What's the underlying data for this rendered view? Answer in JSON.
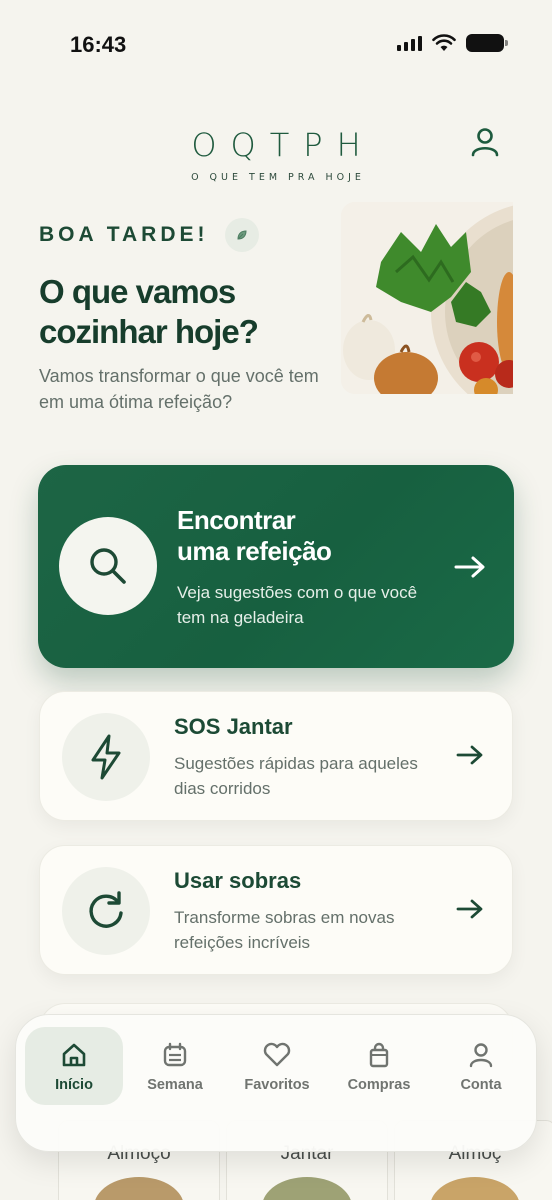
{
  "status": {
    "time": "16:43"
  },
  "brand": {
    "title": "OQTPH",
    "subtitle": "O QUE TEM PRA HOJE"
  },
  "greeting": {
    "label": "BOA TARDE!",
    "headline_line1": "O que vamos",
    "headline_line2": "cozinhar hoje?",
    "subtext": "Vamos transformar o que você tem em uma ótima refeição?"
  },
  "primary_card": {
    "title_line1": "Encontrar",
    "title_line2": "uma refeição",
    "description": "Veja sugestões com o que você tem na geladeira"
  },
  "cards": [
    {
      "title": "SOS Jantar",
      "description": "Sugestões rápidas para aqueles dias corridos",
      "icon": "lightning-icon"
    },
    {
      "title": "Usar sobras",
      "description": "Transforme sobras em novas refeições incríveis",
      "icon": "refresh-icon"
    }
  ],
  "meals": [
    "Almoço",
    "Jantar",
    "Almoç"
  ],
  "nav": {
    "items": [
      {
        "label": "Início",
        "icon": "home-icon",
        "active": true
      },
      {
        "label": "Semana",
        "icon": "calendar-icon",
        "active": false
      },
      {
        "label": "Favoritos",
        "icon": "heart-icon",
        "active": false
      },
      {
        "label": "Compras",
        "icon": "shopping-bag-icon",
        "active": false
      },
      {
        "label": "Conta",
        "icon": "user-icon",
        "active": false
      }
    ]
  },
  "colors": {
    "background": "#f5f4ee",
    "primary": "#1b6343",
    "text_dark": "#173d2c",
    "text_muted": "#64706a"
  }
}
